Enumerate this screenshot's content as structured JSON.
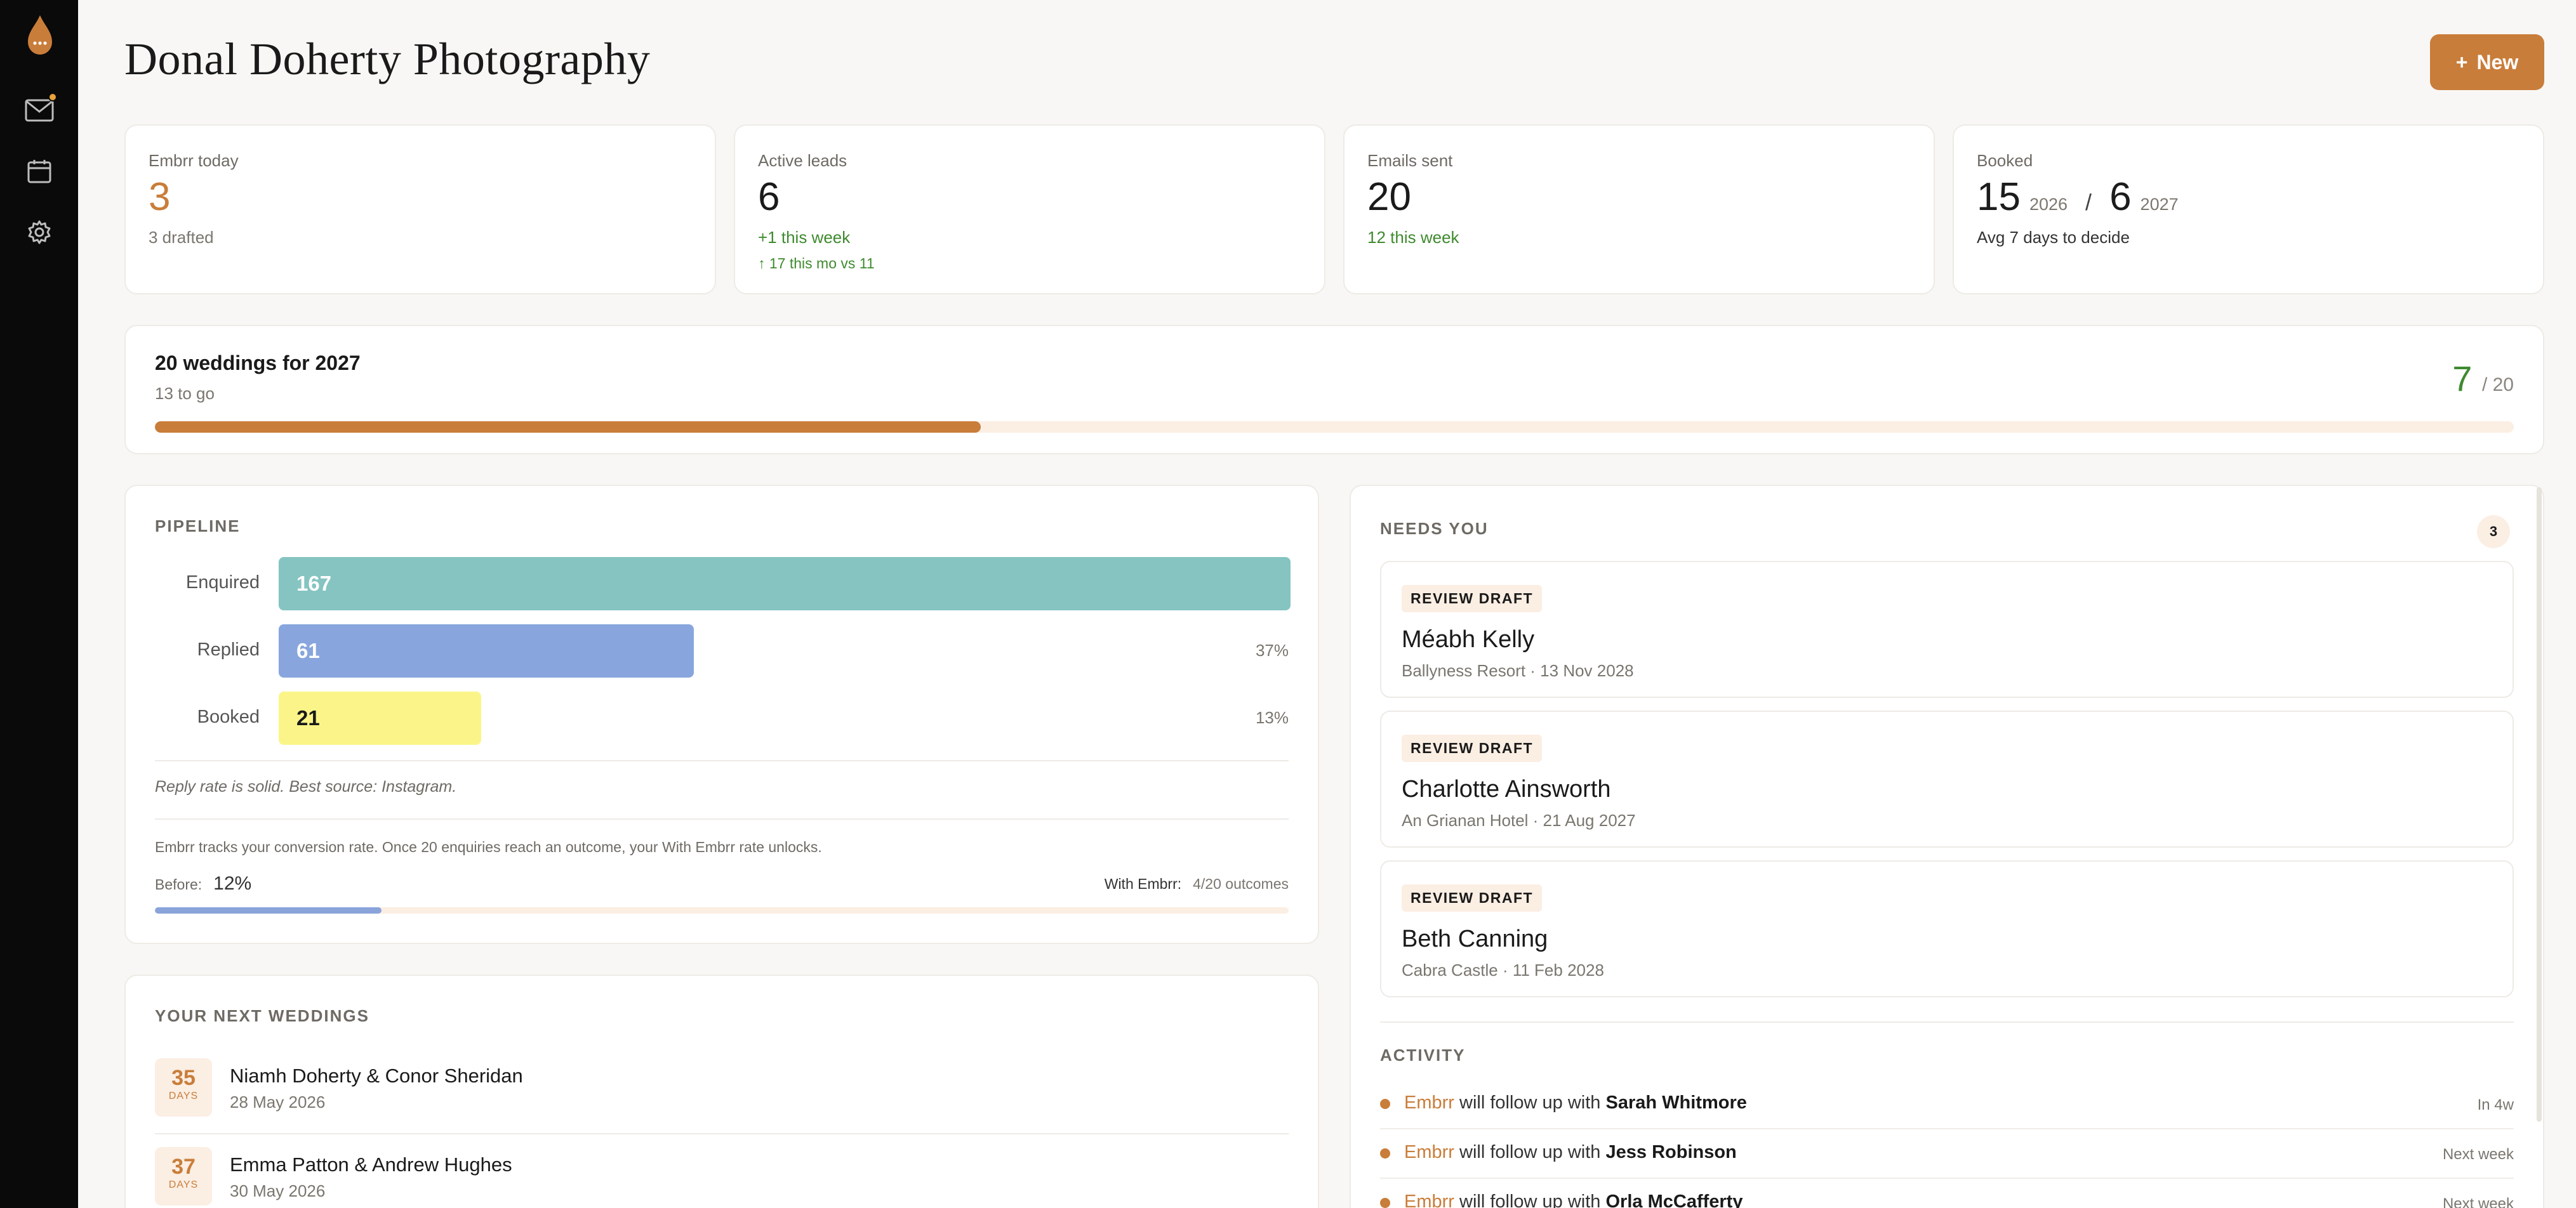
{
  "app": {
    "title": "Donal Doherty Photography",
    "new_button": "New",
    "new_icon": "+"
  },
  "sidebar": {
    "icons": [
      "flame-logo-icon",
      "mail-icon",
      "calendar-icon",
      "gear-icon"
    ]
  },
  "stats": [
    {
      "label": "Embrr today",
      "value": "3",
      "sub": "3 drafted"
    },
    {
      "label": "Active leads",
      "value": "6",
      "sub": "+1 this week",
      "sub2": "↑ 17 this mo vs 11"
    },
    {
      "label": "Emails sent",
      "value": "20",
      "sub": "12 this week"
    },
    {
      "label": "Booked",
      "value_a": "15",
      "year_a": "2026",
      "sep": "/",
      "value_b": "6",
      "year_b": "2027",
      "sub": "Avg 7 days to decide"
    }
  ],
  "goal": {
    "title": "20 weddings for 2027",
    "sub": "13 to go",
    "count": "7",
    "total": "/ 20",
    "progress": 0.35
  },
  "pipeline": {
    "label": "PIPELINE",
    "rows": [
      {
        "name": "Enquired",
        "value": "167",
        "pct": "",
        "fraction": 1.0,
        "color": "#85c4c1"
      },
      {
        "name": "Replied",
        "value": "61",
        "pct": "37%",
        "fraction": 0.41,
        "color": "#88a6dd"
      },
      {
        "name": "Booked",
        "value": "21",
        "pct": "13%",
        "fraction": 0.2,
        "color": "#fbf589"
      }
    ],
    "note": "Reply rate is solid. Best source: Instagram.",
    "conversion_note": "Embrr tracks your conversion rate. Once 20 enquiries reach an outcome, your With Embrr rate unlocks.",
    "before_label": "Before:",
    "before_value": "12%",
    "with_label": "With Embrr:",
    "with_value": "4/20 outcomes",
    "conversion_progress": 0.2
  },
  "weddings": {
    "label": "YOUR NEXT WEDDINGS",
    "items": [
      {
        "days": "35",
        "days_label": "DAYS",
        "name": "Niamh Doherty & Conor Sheridan",
        "date": "28 May 2026"
      },
      {
        "days": "37",
        "days_label": "DAYS",
        "name": "Emma Patton & Andrew Hughes",
        "date": "30 May 2026"
      }
    ]
  },
  "needs": {
    "label": "NEEDS YOU",
    "count": "3",
    "drafts": [
      {
        "tag": "REVIEW DRAFT",
        "name": "Méabh Kelly",
        "sub": "Ballyness Resort · 13 Nov 2028"
      },
      {
        "tag": "REVIEW DRAFT",
        "name": "Charlotte Ainsworth",
        "sub": "An Grianan Hotel · 21 Aug 2027"
      },
      {
        "tag": "REVIEW DRAFT",
        "name": "Beth Canning",
        "sub": "Cabra Castle · 11 Feb 2028"
      }
    ]
  },
  "activity": {
    "label": "ACTIVITY",
    "items": [
      {
        "who": "Embrr",
        "action": "will follow up with",
        "person": "Sarah Whitmore",
        "when": "In 4w"
      },
      {
        "who": "Embrr",
        "action": "will follow up with",
        "person": "Jess Robinson",
        "when": "Next week"
      },
      {
        "who": "Embrr",
        "action": "will follow up with",
        "person": "Orla McCafferty",
        "when": "Next week"
      }
    ]
  },
  "colors": {
    "accent": "#c97d3a",
    "positive": "#3f8a2f",
    "track": "#fbeee3"
  }
}
